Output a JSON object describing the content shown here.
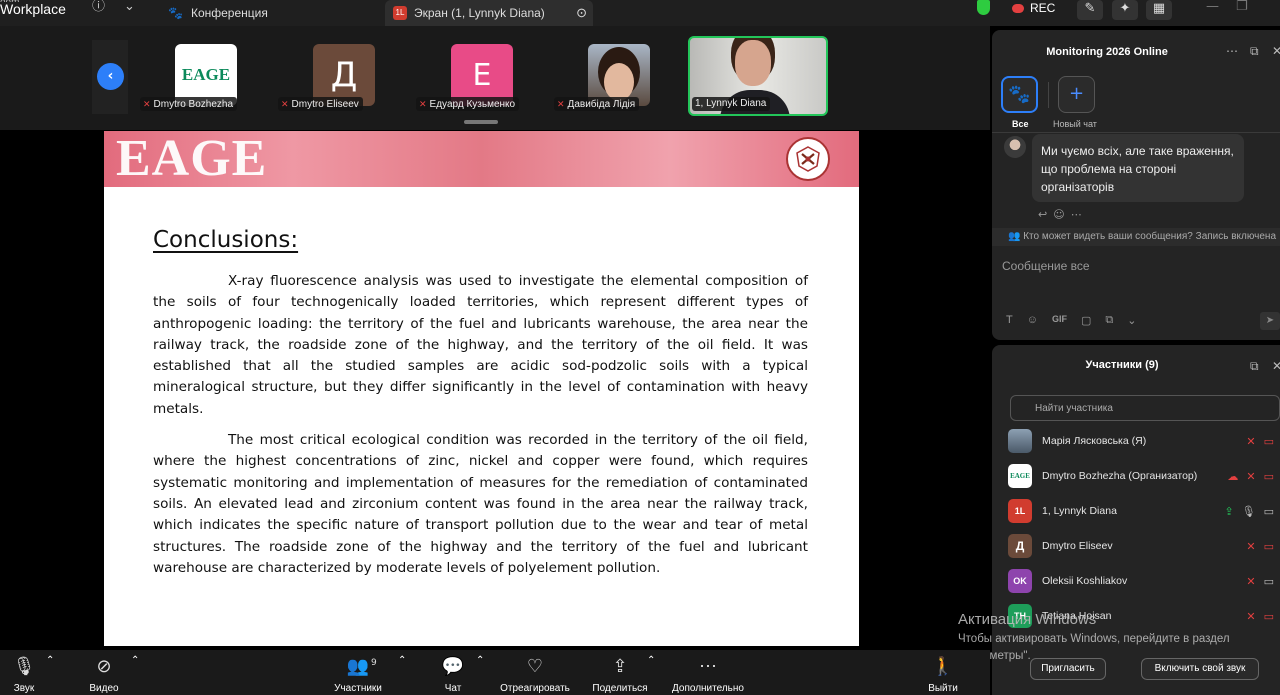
{
  "app": {
    "title_line1": "oom",
    "title_line2": "Workplace"
  },
  "tabs": [
    {
      "label": "Конференция"
    },
    {
      "label": "Экран (1, Lynnyk Diana)",
      "badge": "1L"
    }
  ],
  "topbar": {
    "rec_label": "REC"
  },
  "thumbnails": [
    {
      "name": "Dmytro Bozhezha",
      "avatar_text": "EAGE"
    },
    {
      "name": "Dmytro Eliseev",
      "avatar_text": "Д"
    },
    {
      "name": "Едуард Кузьменко",
      "avatar_text": "E"
    },
    {
      "name": "Давибіда Лідія"
    },
    {
      "name": "1, Lynnyk Diana"
    }
  ],
  "slide": {
    "banner_title": "EAGE",
    "heading": "Conclusions:",
    "paragraphs": [
      "X-ray fluorescence analysis was used to investigate the elemental composition of the soils of four technogenically loaded territories, which represent different types of anthropogenic loading: the territory of the fuel and lubricants warehouse, the area near the railway track, the roadside zone of the highway, and the territory of the oil field. It was established that all the studied samples are acidic sod-podzolic soils with a typical mineralogical structure, but they differ significantly in the level of contamination with heavy metals.",
      "The most critical ecological condition was recorded in the territory of the oil field, where the highest concentrations of zinc, nickel and copper were found, which requires systematic monitoring and implementation of measures for the remediation of contaminated soils. An elevated lead and zirconium content was found in the area near the railway track, which indicates the specific nature of transport pollution due to the wear and tear of metal structures. The roadside zone of the highway and the territory of the fuel and lubricant warehouse are characterized by moderate levels of polyelement pollution."
    ]
  },
  "chat": {
    "title": "Monitoring 2026 Online",
    "all_label": "Все",
    "new_chat_label": "Новый чат",
    "message": "Ми чуємо всіх, але таке враження, що проблема на стороні організаторів",
    "visibility_text": "Кто может видеть ваши сообщения? Запись включена",
    "input_placeholder": "Сообщение все",
    "gif_label": "GIF"
  },
  "participants": {
    "title": "Участники (9)",
    "search_placeholder": "Найти участника",
    "list": [
      {
        "name": "Марія Лясковська (Я)",
        "avatar": "",
        "color": "#6d7f92"
      },
      {
        "name": "Dmytro Bozhezha (Организатор)",
        "avatar": "EAGE",
        "color": "#ffffff"
      },
      {
        "name": "1, Lynnyk Diana",
        "avatar": "1L",
        "color": "#d13c2f"
      },
      {
        "name": "Dmytro Eliseev",
        "avatar": "Д",
        "color": "#6b4a3a"
      },
      {
        "name": "Oleksii Koshliakov",
        "avatar": "OK",
        "color": "#8e44ad"
      },
      {
        "name": "Tetiana Hoisan",
        "avatar": "TH",
        "color": "#1e9e5a"
      }
    ]
  },
  "toolbar": {
    "audio": "Звук",
    "video": "Видео",
    "participants": "Участники",
    "participants_count": "9",
    "chat": "Чат",
    "react": "Отреагировать",
    "share": "Поделиться",
    "more": "Дополнительно",
    "leave": "Выйти"
  },
  "watermark": {
    "line1": "Активация Windows",
    "line2": "Чтобы активировать Windows, перейдите в раздел",
    "line3": "\"Параметры\"."
  },
  "buttons": {
    "invite": "Пригласить",
    "unmute": "Включить свой звук"
  }
}
